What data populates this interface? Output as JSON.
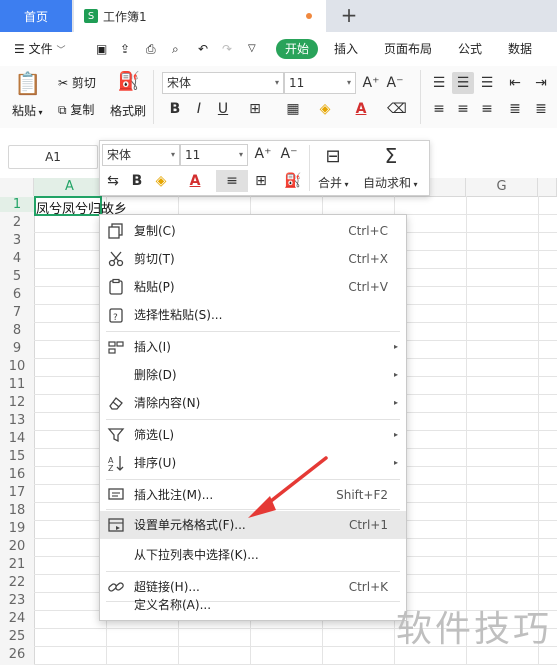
{
  "tabs": {
    "home": "首页",
    "workbook": "工作簿1",
    "workbook_badge": "S"
  },
  "menu": {
    "file": "文件",
    "start": "开始",
    "insert": "插入",
    "page_layout": "页面布局",
    "formula": "公式",
    "data": "数据"
  },
  "ribbon": {
    "paste": "粘贴",
    "cut": "剪切",
    "copy": "复制",
    "format_painter": "格式刷",
    "font_name": "宋体",
    "font_size": "11",
    "grow": "A⁺",
    "shrink": "A⁻",
    "bold": "B",
    "italic": "I",
    "underline": "U"
  },
  "formula_bar": {
    "cell_ref": "A1"
  },
  "mini_toolbar": {
    "font_name": "宋体",
    "font_size": "11",
    "merge": "合并",
    "autosum": "自动求和"
  },
  "sheet": {
    "columns": [
      "A",
      "G"
    ],
    "rows": [
      "1",
      "2",
      "3",
      "4",
      "5",
      "6",
      "7",
      "8",
      "9",
      "10",
      "11",
      "12",
      "13",
      "14",
      "15",
      "16",
      "17",
      "18",
      "19",
      "20",
      "21",
      "22",
      "23",
      "24",
      "25",
      "26"
    ],
    "cell_a1": "凤兮凤兮归故乡"
  },
  "context_menu": {
    "items": [
      {
        "label": "复制(C)",
        "shortcut": "Ctrl+C",
        "icon": "copy-icon"
      },
      {
        "label": "剪切(T)",
        "shortcut": "Ctrl+X",
        "icon": "scissors-icon"
      },
      {
        "label": "粘贴(P)",
        "shortcut": "Ctrl+V",
        "icon": "clipboard-icon"
      },
      {
        "label": "选择性粘贴(S)...",
        "shortcut": "",
        "icon": "paste-special-icon"
      },
      {
        "label": "插入(I)",
        "shortcut": "",
        "icon": "insert-icon"
      },
      {
        "label": "删除(D)",
        "shortcut": "",
        "icon": ""
      },
      {
        "label": "清除内容(N)",
        "shortcut": "",
        "icon": "eraser-icon"
      },
      {
        "label": "筛选(L)",
        "shortcut": "",
        "icon": "filter-icon"
      },
      {
        "label": "排序(U)",
        "shortcut": "",
        "icon": "sort-icon"
      },
      {
        "label": "插入批注(M)...",
        "shortcut": "Shift+F2",
        "icon": "comment-icon"
      },
      {
        "label": "设置单元格格式(F)...",
        "shortcut": "Ctrl+1",
        "icon": "format-cells-icon"
      },
      {
        "label": "从下拉列表中选择(K)...",
        "shortcut": "",
        "icon": ""
      },
      {
        "label": "超链接(H)...",
        "shortcut": "Ctrl+K",
        "icon": "link-icon"
      },
      {
        "label": "定义名称(A)...",
        "shortcut": "",
        "icon": ""
      }
    ]
  },
  "watermark": "软件技巧",
  "colors": {
    "accent_blue": "#3d7ef0",
    "start_green": "#29a35a",
    "selection_green": "#21a366",
    "arrow_red": "#e53935"
  }
}
